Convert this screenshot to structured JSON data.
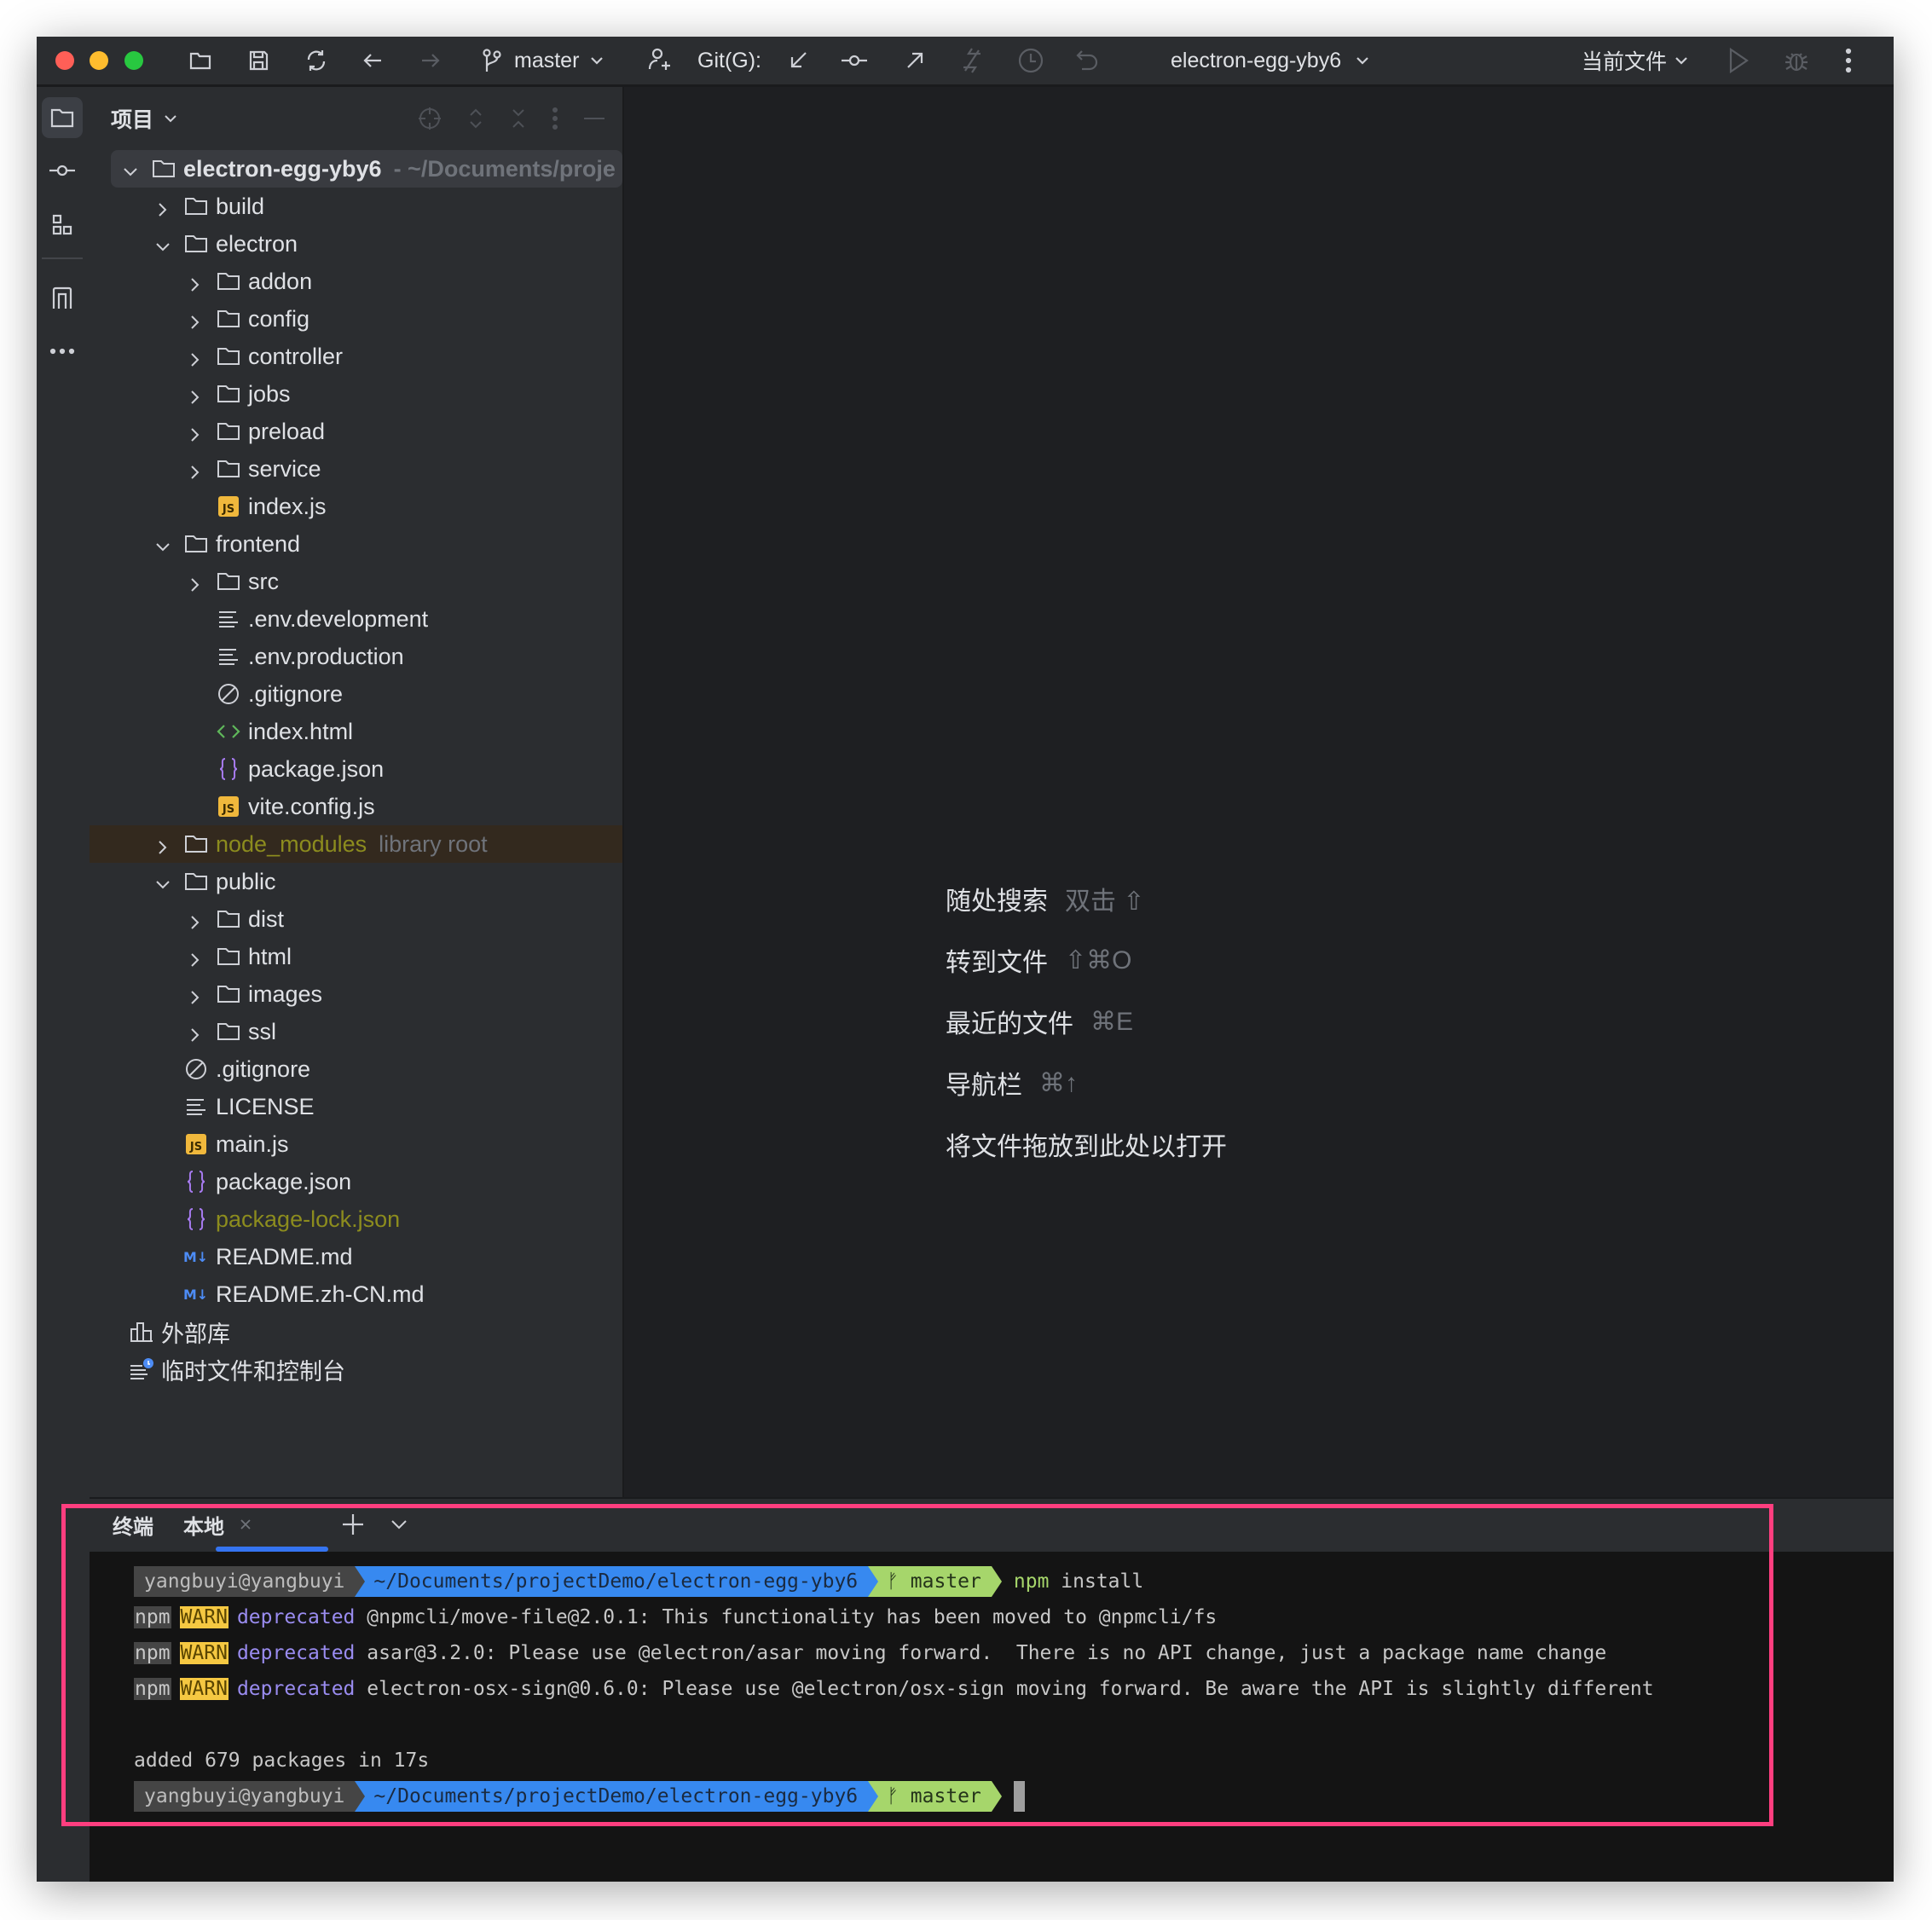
{
  "titlebar": {
    "branch": "master",
    "git_label": "Git(G):",
    "project": "electron-egg-yby6",
    "run_config": "当前文件"
  },
  "panel": {
    "title": "项目",
    "tree": [
      {
        "level": 0,
        "type": "folder",
        "open": true,
        "name": "electron-egg-yby6",
        "extra": "- ~/Documents/proje",
        "bold": true,
        "selected": true
      },
      {
        "level": 1,
        "type": "folder",
        "open": false,
        "name": "build"
      },
      {
        "level": 1,
        "type": "folder",
        "open": true,
        "name": "electron"
      },
      {
        "level": 2,
        "type": "folder",
        "open": false,
        "name": "addon"
      },
      {
        "level": 2,
        "type": "folder",
        "open": false,
        "name": "config"
      },
      {
        "level": 2,
        "type": "folder",
        "open": false,
        "name": "controller"
      },
      {
        "level": 2,
        "type": "folder",
        "open": false,
        "name": "jobs"
      },
      {
        "level": 2,
        "type": "folder",
        "open": false,
        "name": "preload"
      },
      {
        "level": 2,
        "type": "folder",
        "open": false,
        "name": "service"
      },
      {
        "level": 2,
        "type": "js",
        "name": "index.js"
      },
      {
        "level": 1,
        "type": "folder",
        "open": true,
        "name": "frontend"
      },
      {
        "level": 2,
        "type": "folder",
        "open": false,
        "name": "src"
      },
      {
        "level": 2,
        "type": "text",
        "name": ".env.development"
      },
      {
        "level": 2,
        "type": "text",
        "name": ".env.production"
      },
      {
        "level": 2,
        "type": "ignore",
        "name": ".gitignore"
      },
      {
        "level": 2,
        "type": "html",
        "name": "index.html"
      },
      {
        "level": 2,
        "type": "json",
        "name": "package.json"
      },
      {
        "level": 2,
        "type": "js",
        "name": "vite.config.js"
      },
      {
        "level": 1,
        "type": "folder",
        "open": false,
        "name": "node_modules",
        "extra": "library root",
        "color": "#8c8c1e",
        "library": true
      },
      {
        "level": 1,
        "type": "folder",
        "open": true,
        "name": "public"
      },
      {
        "level": 2,
        "type": "folder",
        "open": false,
        "name": "dist"
      },
      {
        "level": 2,
        "type": "folder",
        "open": false,
        "name": "html"
      },
      {
        "level": 2,
        "type": "folder",
        "open": false,
        "name": "images"
      },
      {
        "level": 2,
        "type": "folder",
        "open": false,
        "name": "ssl"
      },
      {
        "level": 1,
        "type": "ignore",
        "name": ".gitignore"
      },
      {
        "level": 1,
        "type": "text",
        "name": "LICENSE"
      },
      {
        "level": 1,
        "type": "js",
        "name": "main.js"
      },
      {
        "level": 1,
        "type": "json",
        "name": "package.json"
      },
      {
        "level": 1,
        "type": "json",
        "name": "package-lock.json",
        "color": "#8c8c1e"
      },
      {
        "level": 1,
        "type": "md",
        "name": "README.md"
      },
      {
        "level": 1,
        "type": "md",
        "name": "README.zh-CN.md"
      },
      {
        "level": 0,
        "type": "libs",
        "name": "外部库"
      },
      {
        "level": 0,
        "type": "scratch",
        "name": "临时文件和控制台"
      }
    ]
  },
  "editor": {
    "hints": [
      {
        "label": "随处搜索",
        "keys": "双击 ⇧"
      },
      {
        "label": "转到文件",
        "keys": "⇧⌘O"
      },
      {
        "label": "最近的文件",
        "keys": "⌘E"
      },
      {
        "label": "导航栏",
        "keys": "⌘↑"
      },
      {
        "label": "将文件拖放到此处以打开",
        "keys": ""
      }
    ]
  },
  "terminal": {
    "title": "终端",
    "tab": "本地",
    "prompt": {
      "user": "yangbuyi@yangbuyi",
      "path": "~/Documents/projectDemo/electron-egg-yby6",
      "branch": "master"
    },
    "command": {
      "bin": "npm",
      "args": " install"
    },
    "warnings": [
      {
        "npm": "npm",
        "level": "WARN",
        "tag": "deprecated",
        "msg": " @npmcli/move-file@2.0.1: This functionality has been moved to @npmcli/fs"
      },
      {
        "npm": "npm",
        "level": "WARN",
        "tag": "deprecated",
        "msg": " asar@3.2.0: Please use @electron/asar moving forward.  There is no API change, just a package name change"
      },
      {
        "npm": "npm",
        "level": "WARN",
        "tag": "deprecated",
        "msg": " electron-osx-sign@0.6.0: Please use @electron/osx-sign moving forward. Be aware the API is slightly different"
      }
    ],
    "summary": "added 679 packages in 17s"
  },
  "colors": {
    "accent": "#3574f0",
    "highlight_box": "#ff3e7f",
    "warn": "#f5c842",
    "path": "#3789f0",
    "git": "#a6d66b"
  }
}
